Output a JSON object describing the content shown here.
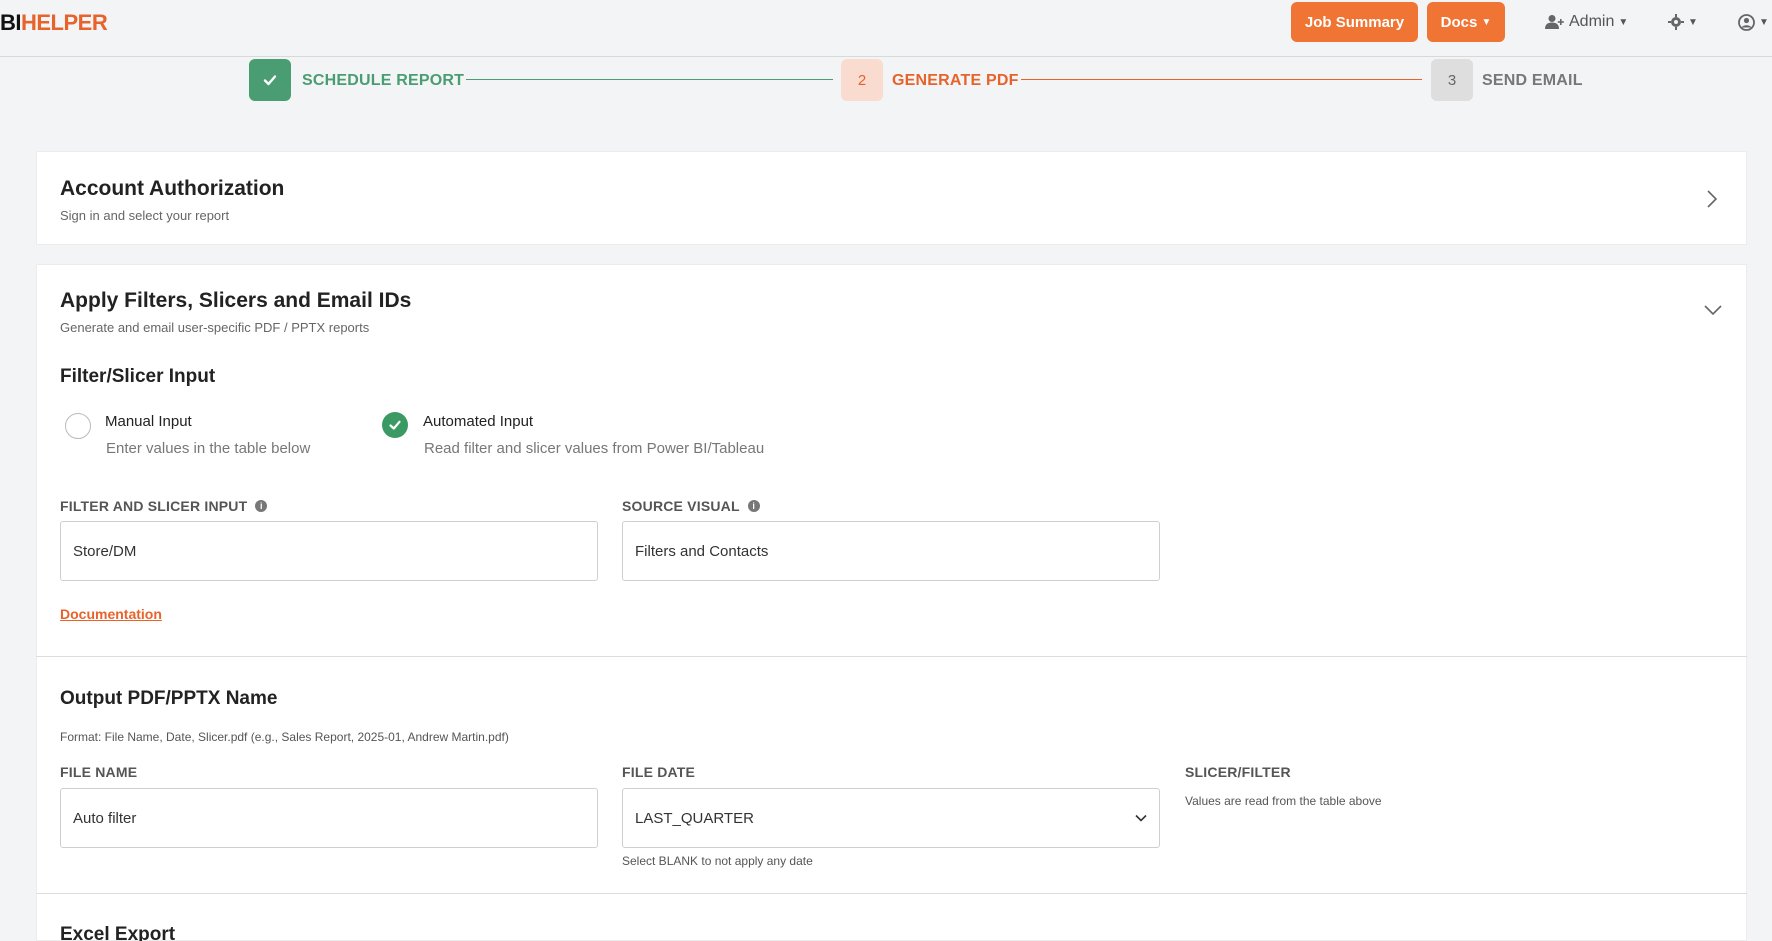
{
  "brand": {
    "part1": "BI",
    "part2": "HELPER"
  },
  "nav": {
    "job_summary": "Job Summary",
    "docs": "Docs",
    "admin": "Admin"
  },
  "colors": {
    "accent": "#f07433",
    "success": "#3b9a63"
  },
  "stepper": {
    "steps": [
      {
        "number": "",
        "label": "SCHEDULE REPORT",
        "state": "complete"
      },
      {
        "number": "2",
        "label": "GENERATE PDF",
        "state": "active"
      },
      {
        "number": "3",
        "label": "SEND EMAIL",
        "state": "pending"
      }
    ]
  },
  "account_card": {
    "title": "Account Authorization",
    "subtitle": "Sign in and select your report"
  },
  "filters_card": {
    "title": "Apply Filters, Slicers and Email IDs",
    "subtitle": "Generate and email user-specific PDF / PPTX reports",
    "section_title": "Filter/Slicer Input",
    "options": [
      {
        "title": "Manual Input",
        "desc": "Enter values in the table below",
        "selected": false
      },
      {
        "title": "Automated Input",
        "desc": "Read filter and slicer values from Power BI/Tableau",
        "selected": true
      }
    ],
    "filter_input_label": "FILTER AND SLICER INPUT",
    "filter_input_value": "Store/DM",
    "source_visual_label": "SOURCE VISUAL",
    "source_visual_value": "Filters and Contacts",
    "documentation_link": "Documentation"
  },
  "output_section": {
    "title": "Output PDF/PPTX Name",
    "format_note": "Format: File Name, Date, Slicer.pdf (e.g., Sales Report, 2025-01, Andrew Martin.pdf)",
    "file_name_label": "FILE NAME",
    "file_name_value": "Auto filter",
    "file_date_label": "FILE DATE",
    "file_date_value": "LAST_QUARTER",
    "file_date_hint": "Select BLANK to not apply any date",
    "slicer_label": "SLICER/FILTER",
    "slicer_note": "Values are read from the table above"
  },
  "excel_section": {
    "title": "Excel Export"
  }
}
